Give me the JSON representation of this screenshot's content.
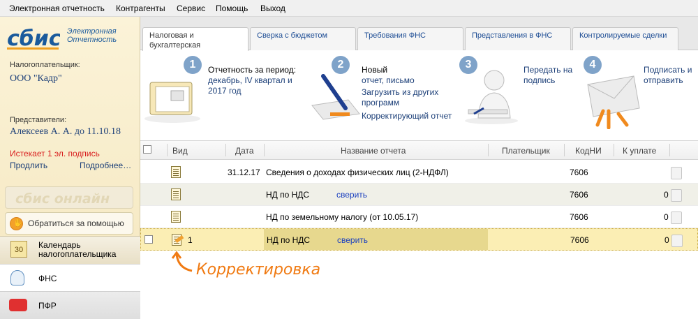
{
  "menu": [
    "Электронная отчетность",
    "Контрагенты",
    "Сервис",
    "Помощь",
    "Выход"
  ],
  "sidebar": {
    "logo_text": "сбис",
    "logo_sub_1": "Электронная",
    "logo_sub_2": "Отчетность",
    "taxpayer_label": "Налогоплательщик:",
    "taxpayer_value": "ООО \"Кадр\"",
    "reps_label": "Представители:",
    "reps_value": "Алексеев А. А. до 11.10.18",
    "expire_text": "Истекает 1 эл. подпись",
    "extend_link": "Продлить",
    "more_link": "Подробнее…",
    "online_text": "сбис онлайн",
    "help_button": "Обратиться за помощью",
    "nav": [
      {
        "label": "Календарь налогоплательщика",
        "icon_text": "30"
      },
      {
        "label": "ФНС"
      },
      {
        "label": "ПФР"
      }
    ]
  },
  "tabs": [
    {
      "label_1": "Налоговая и",
      "label_2": "бухгалтерская отчетность"
    },
    {
      "label_1": "Сверка с бюджетом"
    },
    {
      "label_1": "Требования ФНС"
    },
    {
      "label_1": "Представления в ФНС"
    },
    {
      "label_1": "Контролируемые сделки"
    }
  ],
  "steps": [
    {
      "num": "1",
      "line1": "Отчетность за период:",
      "line2": "декабрь, IV квартал и",
      "line3": "2017 год"
    },
    {
      "num": "2",
      "line1": "Новый",
      "line2": "отчет, письмо",
      "line3": "Загрузить из других",
      "line4": "программ",
      "line5": "Корректирующий отчет"
    },
    {
      "num": "3",
      "line1": "Передать на",
      "line2": "подпись"
    },
    {
      "num": "4",
      "line1": "Подписать и",
      "line2": "отправить"
    }
  ],
  "table": {
    "headers": [
      "Вид",
      "Дата",
      "Название отчета",
      "Плательщик",
      "КодНИ",
      "К уплате"
    ],
    "rows": [
      {
        "vid": "",
        "date": "31.12.17",
        "name": "Сведения о доходах физических лиц (2-НДФЛ)",
        "action": "",
        "code": "7606",
        "pay": ""
      },
      {
        "vid": "",
        "date": "",
        "name": "НД по НДС",
        "action": "сверить",
        "code": "7606",
        "pay": "0"
      },
      {
        "vid": "",
        "date": "",
        "name": "НД по земельному налогу (от 10.05.17)",
        "action": "",
        "code": "7606",
        "pay": "0"
      },
      {
        "vid": "1",
        "date": "",
        "name": "НД по НДС",
        "action": "сверить",
        "code": "7606",
        "pay": "0"
      }
    ]
  },
  "annotation": "Корректировка",
  "colors": {
    "accent": "#f07a12",
    "link": "#1c3f78",
    "highlight": "#fbeeb4"
  }
}
